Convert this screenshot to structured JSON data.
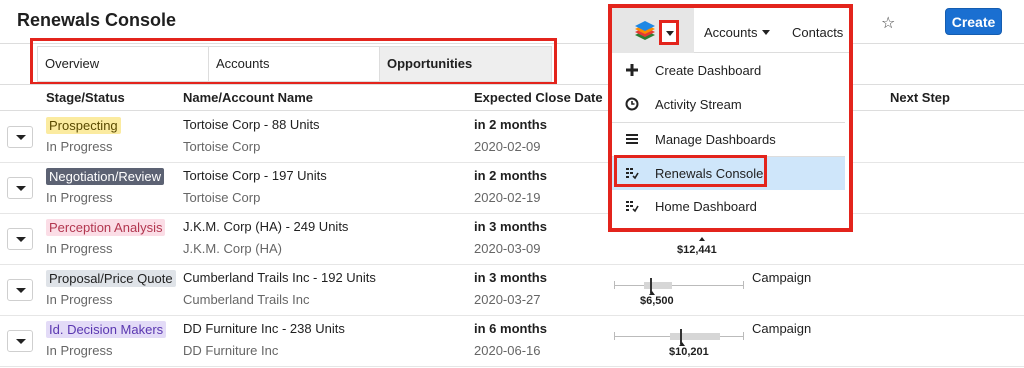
{
  "page": {
    "title": "Renewals Console"
  },
  "tabs": [
    "Overview",
    "Accounts",
    "Opportunities"
  ],
  "columns": {
    "stage": "Stage/Status",
    "name": "Name/Account Name",
    "close": "Expected Close Date",
    "next": "Next Step"
  },
  "rows": [
    {
      "stage": "Prospecting",
      "stage_bg": "#fbeba0",
      "stage_fg": "#5a4a00",
      "status": "In Progress",
      "name": "Tortoise Corp - 88 Units",
      "account": "Tortoise Corp",
      "relative": "in 2 months",
      "date": "2020-02-09",
      "amount": "",
      "next": ""
    },
    {
      "stage": "Negotiation/Review",
      "stage_bg": "#5c6273",
      "stage_fg": "#ffffff",
      "status": "In Progress",
      "name": "Tortoise Corp - 197 Units",
      "account": "Tortoise Corp",
      "relative": "in 2 months",
      "date": "2020-02-19",
      "amount": "",
      "next": ""
    },
    {
      "stage": "Perception Analysis",
      "stage_bg": "#fbdde6",
      "stage_fg": "#b2364f",
      "status": "In Progress",
      "name": "J.K.M. Corp (HA) - 249 Units",
      "account": "J.K.M. Corp (HA)",
      "relative": "in 3 months",
      "date": "2020-03-09",
      "amount": "$12,441",
      "next": ""
    },
    {
      "stage": "Proposal/Price Quote",
      "stage_bg": "#dfe3e8",
      "stage_fg": "#1f1f1f",
      "status": "In Progress",
      "name": "Cumberland Trails Inc - 192 Units",
      "account": "Cumberland Trails Inc",
      "relative": "in 3 months",
      "date": "2020-03-27",
      "amount": "$6,500",
      "next": "Campaign"
    },
    {
      "stage": "Id. Decision Makers",
      "stage_bg": "#e3dbf7",
      "stage_fg": "#5a37b0",
      "status": "In Progress",
      "name": "DD Furniture Inc - 238 Units",
      "account": "DD Furniture Inc",
      "relative": "in 6 months",
      "date": "2020-06-16",
      "amount": "$10,201",
      "next": "Campaign"
    }
  ],
  "header_actions": {
    "create_label": "Create",
    "favorite_icon": "star-icon"
  },
  "nav": {
    "home_icon": "layers-icon",
    "accounts": "Accounts",
    "contacts": "Contacts"
  },
  "menu": [
    {
      "label": "Create Dashboard",
      "icon": "plus-icon"
    },
    {
      "label": "Activity Stream",
      "icon": "clock-icon"
    },
    {
      "label": "Manage Dashboards",
      "icon": "list-icon"
    },
    {
      "label": "Renewals Console",
      "icon": "dashboard-icon"
    },
    {
      "label": "Home Dashboard",
      "icon": "dashboard-icon"
    }
  ],
  "colors": {
    "accent": "#1a6fd1",
    "highlight": "#e3241c",
    "active_menu": "#cfe6fa"
  }
}
